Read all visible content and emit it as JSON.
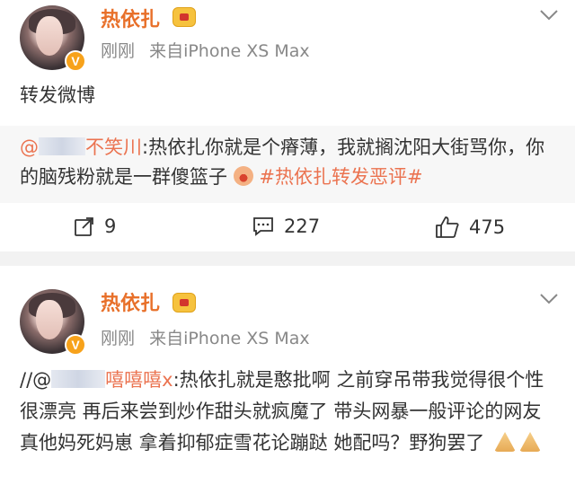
{
  "posts": [
    {
      "username": "热依扎",
      "time": "刚刚",
      "source": "来自iPhone XS Max",
      "text": "转发微博",
      "quote": {
        "prefix": "@",
        "mention": "不笑川",
        "body": ":热依扎你就是个瘠薄，我就搁沈阳大街骂你，你的脑残粉就是一群傻篮子",
        "topic": "#热依扎转发恶评#"
      },
      "actions": {
        "repost": "9",
        "comment": "227",
        "like": "475"
      }
    },
    {
      "username": "热依扎",
      "time": "刚刚",
      "source": "来自iPhone XS Max",
      "prefix": "//@",
      "mention": "嘻嘻嘻x",
      "body": ":热依扎就是憨批啊 之前穿吊带我觉得很个性很漂亮 再后来尝到炒作甜头就疯魔了 带头网暴一般评论的网友 真他妈死妈崽 拿着抑郁症雪花论蹦跶 她配吗？野狗罢了"
    }
  ],
  "colors": {
    "username": "#e8702a",
    "accent": "#eb7350",
    "meta": "#888888",
    "quote_bg": "#f7f7f7"
  },
  "icons": [
    "verified-badge-icon",
    "vip-crown-icon",
    "chevron-down-icon",
    "repost-icon",
    "comment-icon",
    "like-icon"
  ]
}
